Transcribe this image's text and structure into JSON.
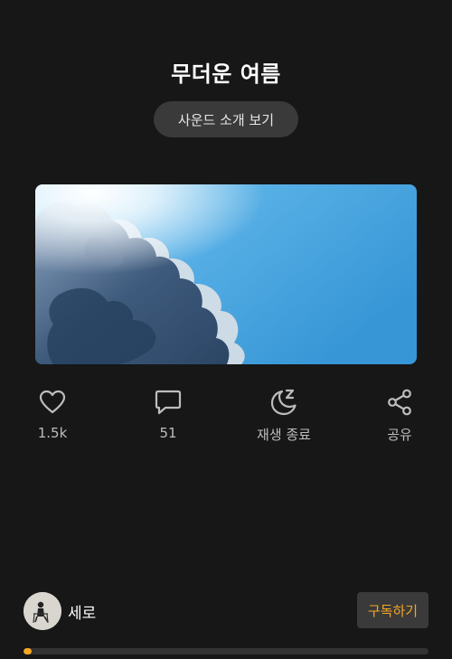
{
  "track": {
    "title": "무더운 여름",
    "intro_button": "사운드 소개 보기"
  },
  "actions": [
    {
      "icon": "heart-icon",
      "label": "1.5k"
    },
    {
      "icon": "comment-icon",
      "label": "51"
    },
    {
      "icon": "sleep-timer-icon",
      "label": "재생 종료"
    },
    {
      "icon": "share-icon",
      "label": "공유"
    }
  ],
  "creator": {
    "name": "세로",
    "subscribe_label": "구독하기"
  },
  "progress": {
    "fraction": 0.02
  },
  "colors": {
    "background": "#171717",
    "accent": "#f5a623",
    "button_bg": "#3a3a3a",
    "sky": "#4aa7e2"
  }
}
